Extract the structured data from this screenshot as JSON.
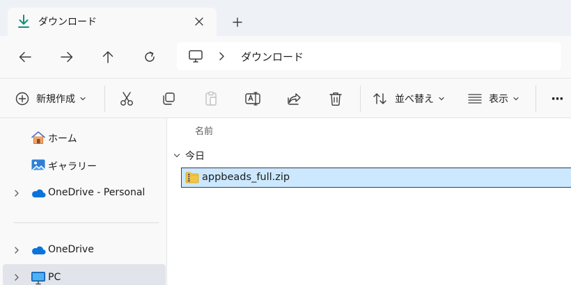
{
  "tab": {
    "title": "ダウンロード"
  },
  "address": {
    "crumb": "ダウンロード"
  },
  "commands": {
    "new_label": "新規作成",
    "sort_label": "並べ替え",
    "view_label": "表示",
    "more_label": "···"
  },
  "sidebar": {
    "items": [
      {
        "label": "ホーム"
      },
      {
        "label": "ギャラリー"
      },
      {
        "label": "OneDrive - Personal"
      },
      {
        "label": "OneDrive"
      },
      {
        "label": "PC"
      }
    ]
  },
  "content": {
    "column_name": "名前",
    "group_label": "今日",
    "files": [
      {
        "name": "appbeads_full.zip"
      }
    ]
  },
  "colors": {
    "accent_download": "#0f8f7e",
    "selection": "#cce8ff",
    "onedrive_blue": "#0a74da"
  }
}
